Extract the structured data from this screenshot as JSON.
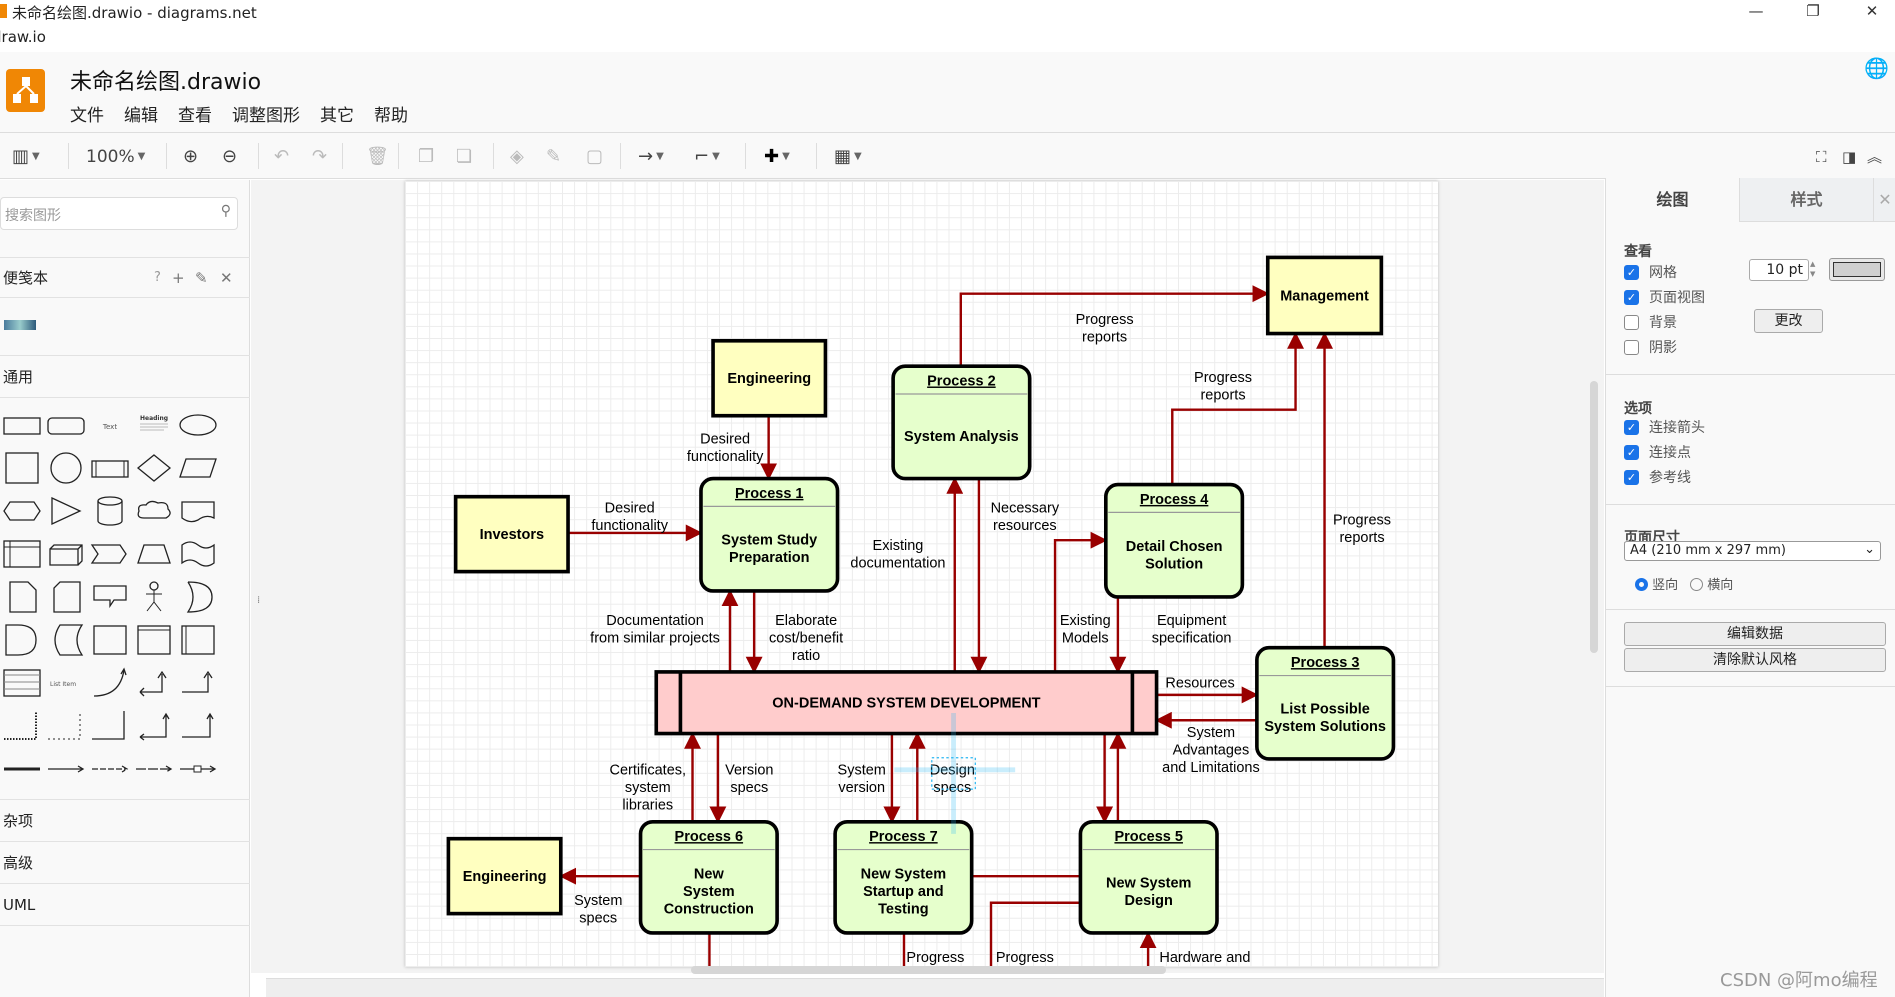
{
  "window": {
    "title": "未命名绘图.drawio - diagrams.net",
    "url": "draw.io",
    "controls": [
      "minimize",
      "restore",
      "close"
    ]
  },
  "header": {
    "filename": "未命名绘图.drawio",
    "menu": [
      "文件",
      "编辑",
      "查看",
      "调整图形",
      "其它",
      "帮助"
    ]
  },
  "toolbar": {
    "zoom": "100%",
    "icons": [
      "format-panel-icon",
      "zoom-in-icon",
      "zoom-out-icon",
      "undo-icon",
      "redo-icon",
      "delete-icon",
      "to-front-icon",
      "to-back-icon",
      "fill-color-icon",
      "line-color-icon",
      "shadow-icon",
      "connection-icon",
      "waypoints-icon",
      "insert-icon",
      "table-icon",
      "fullscreen-icon",
      "toggle-panel-icon",
      "collapse-icon"
    ]
  },
  "sidebar": {
    "search_placeholder": "搜索图形",
    "scratchpad": "便笺本",
    "scratchpad_actions": [
      "?",
      "+",
      "✎",
      "✕"
    ],
    "general": "通用",
    "shape_texts": {
      "text": "Text",
      "heading": "Heading",
      "list_item": "List Item"
    },
    "sections": [
      "杂项",
      "高级",
      "UML"
    ]
  },
  "diagram": {
    "nodes": [
      {
        "title": "",
        "body": "Management"
      },
      {
        "title": "",
        "body": "Engineering"
      },
      {
        "title": "",
        "body": "Investors"
      },
      {
        "title": "Process 1",
        "body": "System Study\nPreparation"
      },
      {
        "title": "Process 2",
        "body": "System Analysis"
      },
      {
        "title": "Process 4",
        "body": "Detail Chosen\nSolution"
      },
      {
        "title": "Process 3",
        "body": "List Possible\nSystem Solutions"
      },
      {
        "title": "",
        "body": "ON-DEMAND SYSTEM DEVELOPMENT"
      },
      {
        "title": "Process 6",
        "body": "New\nSystem\nConstruction"
      },
      {
        "title": "Process 7",
        "body": "New System\nStartup and\nTesting"
      },
      {
        "title": "Process 5",
        "body": "New System\nDesign"
      },
      {
        "title": "",
        "body": "Engineering"
      }
    ],
    "labels": [
      "Progress\nreports",
      "Progress\nreports",
      "Progress\nreports",
      "Desired\nfunctionality",
      "Desired\nfunctionality",
      "Necessary\nresources",
      "Existing\ndocumentation",
      "Documentation\nfrom similar projects",
      "Elaborate\ncost/benefit\nratio",
      "Existing\nModels",
      "Equipment\nspecification",
      "Resources",
      "System\nAdvantages\nand Limitations",
      "Certificates,\nsystem\nlibraries",
      "Version\nspecs",
      "System\nversion",
      "Design\nspecs",
      "System\nspecs",
      "Progress",
      "Progress",
      "Hardware and"
    ],
    "colors": {
      "external": "#ffffc0",
      "process": "#e6ffcc",
      "center": "#ffcccc",
      "edge": "#990000"
    }
  },
  "panel": {
    "tabs": [
      "绘图",
      "样式"
    ],
    "view_title": "查看",
    "view_options": [
      {
        "label": "网格",
        "checked": true
      },
      {
        "label": "页面视图",
        "checked": true
      },
      {
        "label": "背景",
        "checked": false
      },
      {
        "label": "阴影",
        "checked": false
      }
    ],
    "grid_size": "10 pt",
    "change_button": "更改",
    "options_title": "选项",
    "options": [
      {
        "label": "连接箭头",
        "checked": true
      },
      {
        "label": "连接点",
        "checked": true
      },
      {
        "label": "参考线",
        "checked": true
      }
    ],
    "page_size_title": "页面尺寸",
    "page_size": "A4 (210 mm x 297 mm)",
    "orientation": [
      {
        "label": "竖向",
        "selected": true
      },
      {
        "label": "横向",
        "selected": false
      }
    ],
    "edit_data": "编辑数据",
    "clear_style": "清除默认风格"
  },
  "watermark": "CSDN @阿mo编程"
}
